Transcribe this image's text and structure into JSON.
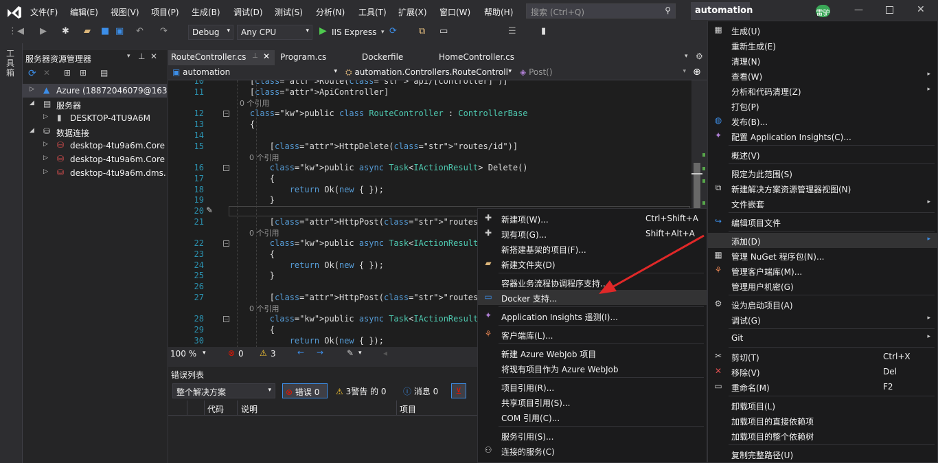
{
  "menubar": {
    "items": [
      "文件(F)",
      "编辑(E)",
      "视图(V)",
      "项目(P)",
      "生成(B)",
      "调试(D)",
      "测试(S)",
      "分析(N)",
      "工具(T)",
      "扩展(X)",
      "窗口(W)",
      "帮助(H)"
    ],
    "search_placeholder": "搜索 (Ctrl+Q)",
    "project_name": "automation",
    "user_badge": "雷驴"
  },
  "toolbar": {
    "config": "Debug",
    "platform": "Any CPU",
    "run_label": "IIS Express"
  },
  "left_strip": {
    "label": "工具箱"
  },
  "server_explorer": {
    "title": "服务器资源管理器",
    "rows": [
      {
        "text": "Azure (18872046079@163",
        "indent": 0,
        "expander": "▷",
        "icon": "azure-icon"
      },
      {
        "text": "服务器",
        "indent": 0,
        "expander": "◢",
        "icon": "server-icon"
      },
      {
        "text": "DESKTOP-4TU9A6M",
        "indent": 1,
        "expander": "▷",
        "icon": "computer-icon"
      },
      {
        "text": "数据连接",
        "indent": 0,
        "expander": "◢",
        "icon": "database-icon"
      },
      {
        "text": "desktop-4tu9a6m.Core",
        "indent": 1,
        "expander": "▷",
        "icon": "db-error-icon"
      },
      {
        "text": "desktop-4tu9a6m.Core",
        "indent": 1,
        "expander": "▷",
        "icon": "db-error-icon"
      },
      {
        "text": "desktop-4tu9a6m.dms.",
        "indent": 1,
        "expander": "▷",
        "icon": "db-error-icon"
      }
    ]
  },
  "editor": {
    "tabs": [
      "RouteController.cs",
      "Program.cs",
      "Dockerfile",
      "HomeController.cs"
    ],
    "nav": {
      "project": "automation",
      "class": "automation.Controllers.RouteControll",
      "member": "Post()"
    },
    "codelens": "0 个引用",
    "lines": [
      {
        "n": "10",
        "t": "    [Route(\"api/[controller]\")]"
      },
      {
        "n": "11",
        "t": "    [ApiController]"
      },
      {
        "n": "",
        "t": "    0 个引用"
      },
      {
        "n": "12",
        "t": "    public class RouteController : ControllerBase"
      },
      {
        "n": "13",
        "t": "    {"
      },
      {
        "n": "14",
        "t": ""
      },
      {
        "n": "15",
        "t": "        [HttpDelete(\"routes/id\")]"
      },
      {
        "n": "",
        "t": "        0 个引用"
      },
      {
        "n": "16",
        "t": "        public async Task<IActionResult> Delete()"
      },
      {
        "n": "17",
        "t": "        {"
      },
      {
        "n": "18",
        "t": "            return Ok(new { });"
      },
      {
        "n": "19",
        "t": "        }"
      },
      {
        "n": "20",
        "t": ""
      },
      {
        "n": "21",
        "t": "        [HttpPost(\"routes\")]"
      },
      {
        "n": "",
        "t": "        0 个引用"
      },
      {
        "n": "22",
        "t": "        public async Task<IActionResult> Post()"
      },
      {
        "n": "23",
        "t": "        {"
      },
      {
        "n": "24",
        "t": "            return Ok(new { });"
      },
      {
        "n": "25",
        "t": "        }"
      },
      {
        "n": "26",
        "t": ""
      },
      {
        "n": "27",
        "t": "        [HttpPost(\"routes\")]"
      },
      {
        "n": "",
        "t": "        0 个引用"
      },
      {
        "n": "28",
        "t": "        public async Task<IActionResult> Put()"
      },
      {
        "n": "29",
        "t": "        {"
      },
      {
        "n": "30",
        "t": "            return Ok(new { });"
      }
    ],
    "status": {
      "zoom": "100 %",
      "errors": "0",
      "warnings": "3"
    }
  },
  "error_list": {
    "title": "错误列表",
    "scope": "整个解决方案",
    "errors": "错误 0",
    "warnings": "3警告 的 0",
    "messages": "消息 0",
    "columns": [
      "代码",
      "说明",
      "项目"
    ]
  },
  "context_menu_add": {
    "items": [
      {
        "label": "新建项(W)...",
        "shortcut": "Ctrl+Shift+A",
        "icon": "new-item-icon"
      },
      {
        "label": "现有项(G)...",
        "shortcut": "Shift+Alt+A",
        "icon": "existing-item-icon"
      },
      {
        "label": "新搭建基架的项目(F)...",
        "shortcut": "",
        "icon": ""
      },
      {
        "label": "新建文件夹(D)",
        "shortcut": "",
        "icon": "new-folder-icon"
      },
      {
        "label": "容器业务流程协调程序支持...",
        "shortcut": "",
        "icon": ""
      },
      {
        "label": "Docker 支持...",
        "shortcut": "",
        "icon": "docker-icon"
      },
      {
        "label": "Application Insights 遥测(I)...",
        "shortcut": "",
        "icon": "insights-icon"
      },
      {
        "label": "客户端库(L)...",
        "shortcut": "",
        "icon": "client-lib-icon"
      },
      {
        "label": "新建 Azure WebJob 项目",
        "shortcut": "",
        "icon": ""
      },
      {
        "label": "将现有项目作为 Azure WebJob",
        "shortcut": "",
        "icon": ""
      },
      {
        "label": "项目引用(R)...",
        "shortcut": "",
        "icon": ""
      },
      {
        "label": "共享项目引用(S)...",
        "shortcut": "",
        "icon": ""
      },
      {
        "label": "COM 引用(C)...",
        "shortcut": "",
        "icon": ""
      },
      {
        "label": "服务引用(S)...",
        "shortcut": "",
        "icon": ""
      },
      {
        "label": "连接的服务(C)",
        "shortcut": "",
        "icon": "connected-service-icon"
      }
    ]
  },
  "context_menu_project": {
    "items": [
      {
        "label": "生成(U)",
        "icon": "build-icon",
        "shortcut": ""
      },
      {
        "label": "重新生成(E)",
        "icon": "",
        "shortcut": ""
      },
      {
        "label": "清理(N)",
        "icon": "",
        "shortcut": ""
      },
      {
        "label": "查看(W)",
        "icon": "",
        "shortcut": ""
      },
      {
        "label": "分析和代码清理(Z)",
        "icon": "",
        "shortcut": ""
      },
      {
        "label": "打包(P)",
        "icon": "",
        "shortcut": ""
      },
      {
        "label": "发布(B)...",
        "icon": "publish-icon",
        "shortcut": ""
      },
      {
        "label": "配置 Application Insights(C)...",
        "icon": "insights-icon",
        "shortcut": ""
      },
      {
        "label": "概述(V)",
        "icon": "",
        "shortcut": ""
      },
      {
        "label": "限定为此范围(S)",
        "icon": "",
        "shortcut": ""
      },
      {
        "label": "新建解决方案资源管理器视图(N)",
        "icon": "new-view-icon",
        "shortcut": ""
      },
      {
        "label": "文件嵌套",
        "icon": "",
        "shortcut": ""
      },
      {
        "label": "编辑项目文件",
        "icon": "edit-project-icon",
        "shortcut": ""
      },
      {
        "label": "添加(D)",
        "icon": "",
        "shortcut": ""
      },
      {
        "label": "管理 NuGet 程序包(N)...",
        "icon": "nuget-icon",
        "shortcut": ""
      },
      {
        "label": "管理客户端库(M)...",
        "icon": "client-lib-icon",
        "shortcut": ""
      },
      {
        "label": "管理用户机密(G)",
        "icon": "",
        "shortcut": ""
      },
      {
        "label": "设为启动项目(A)",
        "icon": "gear-icon",
        "shortcut": ""
      },
      {
        "label": "调试(G)",
        "icon": "",
        "shortcut": ""
      },
      {
        "label": "Git",
        "icon": "",
        "shortcut": ""
      },
      {
        "label": "剪切(T)",
        "icon": "cut-icon",
        "shortcut": "Ctrl+X"
      },
      {
        "label": "移除(V)",
        "icon": "remove-icon",
        "shortcut": "Del"
      },
      {
        "label": "重命名(M)",
        "icon": "rename-icon",
        "shortcut": "F2"
      },
      {
        "label": "卸载项目(L)",
        "icon": "",
        "shortcut": ""
      },
      {
        "label": "加载项目的直接依赖项",
        "icon": "",
        "shortcut": ""
      },
      {
        "label": "加载项目的整个依赖树",
        "icon": "",
        "shortcut": ""
      },
      {
        "label": "复制完整路径(U)",
        "icon": "",
        "shortcut": ""
      }
    ]
  },
  "colors": {
    "accent": "#007acc",
    "bg": "#2d2d30",
    "editor_bg": "#1e1e1e",
    "menu_bg": "#1b1b1c",
    "arrow": "#e02828"
  }
}
